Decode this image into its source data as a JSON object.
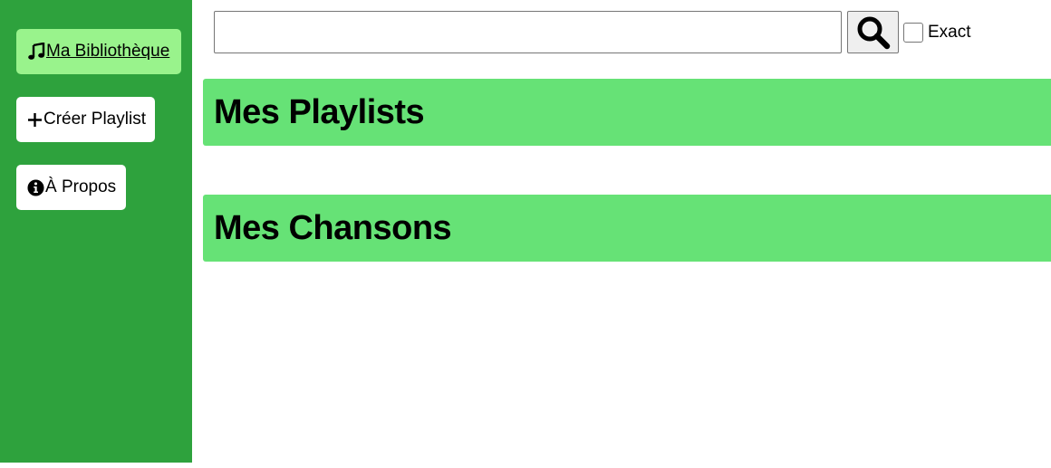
{
  "sidebar": {
    "items": [
      {
        "label": "Ma Bibliothèque",
        "icon": "music-note-icon",
        "active": true
      },
      {
        "label": "Créer Playlist",
        "icon": "plus-icon",
        "active": false
      },
      {
        "label": "À Propos",
        "icon": "info-icon",
        "active": false
      }
    ]
  },
  "search": {
    "value": "",
    "placeholder": "",
    "button_icon": "search-icon",
    "exact_label": "Exact",
    "exact_checked": false
  },
  "main": {
    "playlists_title": "Mes Playlists",
    "songs_title": "Mes Chansons"
  },
  "colors": {
    "sidebar_bg": "#2ea23d",
    "active_nav_bg": "#99f38c",
    "section_header_bg": "#66e276"
  }
}
